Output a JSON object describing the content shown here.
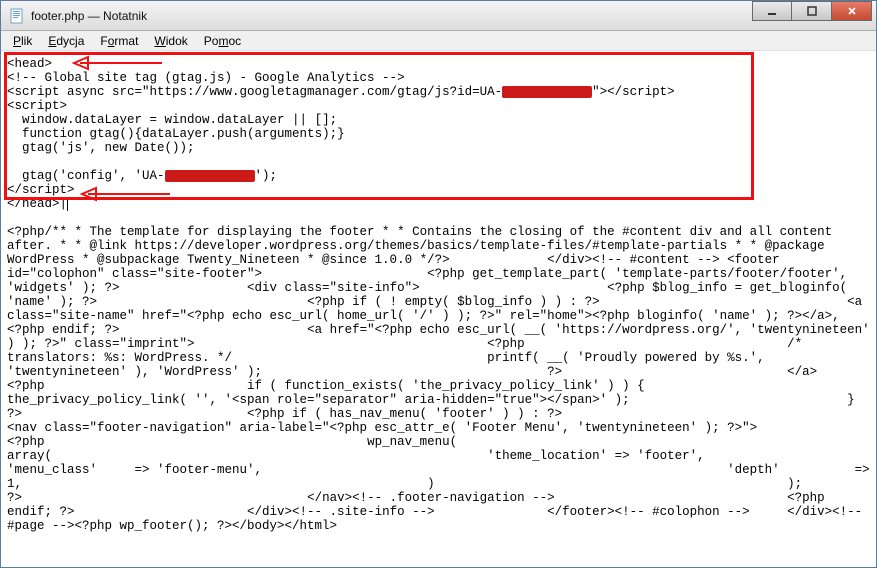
{
  "window": {
    "title": "footer.php — Notatnik"
  },
  "menubar": {
    "items": [
      {
        "label": "Plik",
        "underline": 0
      },
      {
        "label": "Edycja",
        "underline": 0
      },
      {
        "label": "Format",
        "underline": 1
      },
      {
        "label": "Widok",
        "underline": 0
      },
      {
        "label": "Pomoc",
        "underline": 2
      }
    ]
  },
  "code": {
    "highlighted": [
      "<head>",
      "<!-- Global site tag (gtag.js) - Google Analytics -->",
      "<script async src=\"https://www.googletagmanager.com/gtag/js?id=UA-REDACTED\"></script>",
      "<script>",
      "  window.dataLayer = window.dataLayer || [];",
      "  function gtag(){dataLayer.push(arguments);}",
      "  gtag('js', new Date());",
      "",
      "  gtag('config', 'UA-REDACTED');",
      "</script>",
      "</head>"
    ],
    "rest": "<?php/** * The template for displaying the footer * * Contains the closing of the #content div and all content after. * * @link https://developer.wordpress.org/themes/basics/template-files/#template-partials * * @package WordPress * @subpackage Twenty_Nineteen * @since 1.0.0 */?>\t\t</div><!-- #content --> <footer id=\"colophon\" class=\"site-footer\">\t\t\t<?php get_template_part( 'template-parts/footer/footer', 'widgets' ); ?>\t\t\t<div class=\"site-info\">\t\t\t\t<?php $blog_info = get_bloginfo( 'name' ); ?>\t\t\t\t<?php if ( ! empty( $blog_info ) ) : ?>\t\t\t\t\t<a class=\"site-name\" href=\"<?php echo esc_url( home_url( '/' ) ); ?>\" rel=\"home\"><?php bloginfo( 'name' ); ?></a>,\t\t\t\t<?php endif; ?>\t\t\t\t<a href=\"<?php echo esc_url( __( 'https://wordpress.org/', 'twentynineteen' ) ); ?>\" class=\"imprint\">\t\t\t\t\t<?php\t\t\t\t\t/* translators: %s: WordPress. */\t\t\t\t\tprintf( __( 'Proudly powered by %s.', 'twentynineteen' ), 'WordPress' );\t\t\t\t\t?>\t\t\t\t</a>\t\t\t\t<?php\t\t\t\tif ( function_exists( 'the_privacy_policy_link' ) ) {\t\t\t\t\tthe_privacy_policy_link( '', '<span role=\"separator\" aria-hidden=\"true\"></span>' );\t\t\t\t}\t\t\t\t?>\t\t\t\t<?php if ( has_nav_menu( 'footer' ) ) : ?>\t\t\t\t\t<nav class=\"footer-navigation\" aria-label=\"<?php esc_attr_e( 'Footer Menu', 'twentynineteen' ); ?>\">\t\t\t\t\t\t<?php\t\t\t\t\t\twp_nav_menu(\t\t\t\t\t\t\tarray(\t\t\t\t\t\t\t\t'theme_location' => 'footer',\t\t\t\t\t\t\t\t'menu_class'     => 'footer-menu',\t\t\t\t\t\t\t\t'depth'          => 1,\t\t\t\t\t\t\t)\t\t\t\t\t\t);\t\t\t\t\t\t?>\t\t\t\t\t</nav><!-- .footer-navigation -->\t\t\t\t<?php endif; ?>\t\t\t</div><!-- .site-info -->\t\t</footer><!-- #colophon -->\t</div><!-- #page --><?php wp_footer(); ?></body></html>"
  }
}
